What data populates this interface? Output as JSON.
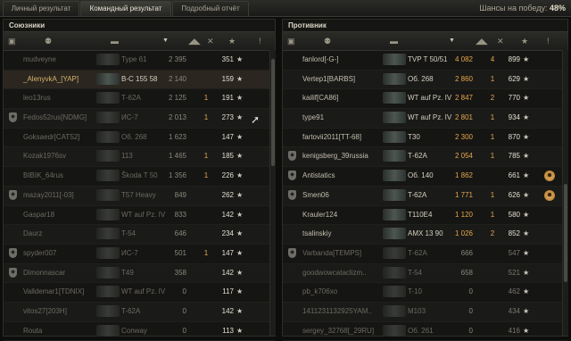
{
  "tabs": [
    "Личный результат",
    "Командный результат",
    "Подробный отчёт"
  ],
  "active_tab": 1,
  "win_chance": {
    "label": "Шансы на победу:",
    "value": "48%"
  },
  "allies": {
    "title": "Союзники",
    "rows": [
      {
        "name": "mudveyne",
        "tank": "Type 61",
        "damage": "2 395",
        "kills": "",
        "xp": "351",
        "badge": false,
        "state": "dead"
      },
      {
        "name": "_AlenyvkA_[YAP]",
        "tank": "В-С 155 58",
        "damage": "2 140",
        "kills": "",
        "xp": "159",
        "badge": false,
        "state": "self"
      },
      {
        "name": "leo13rus",
        "tank": "Т-62А",
        "damage": "2 125",
        "kills": "1",
        "xp": "191",
        "badge": false,
        "state": "dead"
      },
      {
        "name": "Fedos52rus[NDMG]",
        "tank": "ИС-7",
        "damage": "2 013",
        "kills": "1",
        "xp": "273",
        "badge": true,
        "state": "dead"
      },
      {
        "name": "Goksaedr[CAT52]",
        "tank": "Об. 268",
        "damage": "1 623",
        "kills": "",
        "xp": "147",
        "badge": false,
        "state": "dead"
      },
      {
        "name": "Kozak1976sv",
        "tank": "113",
        "damage": "1 465",
        "kills": "1",
        "xp": "185",
        "badge": false,
        "state": "dead"
      },
      {
        "name": "BIBIK_64rus",
        "tank": "Škoda T 50",
        "damage": "1 356",
        "kills": "1",
        "xp": "226",
        "badge": false,
        "state": "dead"
      },
      {
        "name": "mazay2011[-03]",
        "tank": "T57 Heavy",
        "damage": "849",
        "kills": "",
        "xp": "262",
        "badge": true,
        "state": "dead"
      },
      {
        "name": "Gaspar18",
        "tank": "WT auf Pz. IV",
        "damage": "833",
        "kills": "",
        "xp": "142",
        "badge": false,
        "state": "dead"
      },
      {
        "name": "Daurz",
        "tank": "T-54",
        "damage": "646",
        "kills": "",
        "xp": "234",
        "badge": false,
        "state": "dead"
      },
      {
        "name": "spyder007",
        "tank": "ИС-7",
        "damage": "501",
        "kills": "1",
        "xp": "147",
        "badge": true,
        "state": "dead"
      },
      {
        "name": "Dimonnascar",
        "tank": "T49",
        "damage": "358",
        "kills": "",
        "xp": "142",
        "badge": true,
        "state": "dead"
      },
      {
        "name": "Valldemar1[TDNIX]",
        "tank": "WT auf Pz. IV",
        "damage": "0",
        "kills": "",
        "xp": "117",
        "badge": false,
        "state": "dead"
      },
      {
        "name": "vitos27[203H]",
        "tank": "T-62A",
        "damage": "0",
        "kills": "",
        "xp": "142",
        "badge": false,
        "state": "dead"
      },
      {
        "name": "Routa",
        "tank": "Conway",
        "damage": "0",
        "kills": "",
        "xp": "113",
        "badge": false,
        "state": "dead"
      }
    ]
  },
  "enemies": {
    "title": "Противник",
    "rows": [
      {
        "name": "fanlord[-G-]",
        "tank": "TVP T 50/51",
        "damage": "4 082",
        "kills": "4",
        "xp": "899",
        "badge": false,
        "state": "alive",
        "medal": false
      },
      {
        "name": "Vertep1[BARBS]",
        "tank": "Об. 268",
        "damage": "2 860",
        "kills": "1",
        "xp": "629",
        "badge": false,
        "state": "alive",
        "medal": false
      },
      {
        "name": "kailif[CA86]",
        "tank": "WT auf Pz. IV",
        "damage": "2 847",
        "kills": "2",
        "xp": "770",
        "badge": false,
        "state": "alive",
        "medal": false
      },
      {
        "name": "type91",
        "tank": "WT auf Pz. IV",
        "damage": "2 801",
        "kills": "1",
        "xp": "934",
        "badge": false,
        "state": "alive",
        "medal": false
      },
      {
        "name": "fartovii2011[TT-68]",
        "tank": "T30",
        "damage": "2 300",
        "kills": "1",
        "xp": "870",
        "badge": false,
        "state": "alive",
        "medal": false
      },
      {
        "name": "kenigsberg_39russia",
        "tank": "Т-62А",
        "damage": "2 054",
        "kills": "1",
        "xp": "785",
        "badge": true,
        "state": "alive",
        "medal": false
      },
      {
        "name": "Antistatics",
        "tank": "Об. 140",
        "damage": "1 862",
        "kills": "",
        "xp": "661",
        "badge": true,
        "state": "alive",
        "medal": true
      },
      {
        "name": "Smen06",
        "tank": "T-62A",
        "damage": "1 771",
        "kills": "1",
        "xp": "626",
        "badge": true,
        "state": "alive",
        "medal": true
      },
      {
        "name": "Krauler124",
        "tank": "T110E4",
        "damage": "1 120",
        "kills": "1",
        "xp": "580",
        "badge": false,
        "state": "alive",
        "medal": false
      },
      {
        "name": "tsalinskiy",
        "tank": "AMX 13 90",
        "damage": "1 026",
        "kills": "2",
        "xp": "852",
        "badge": false,
        "state": "alive",
        "medal": false
      },
      {
        "name": "Varbanda[TEMPS]",
        "tank": "Т-62А",
        "damage": "666",
        "kills": "",
        "xp": "547",
        "badge": true,
        "state": "dead",
        "medal": false
      },
      {
        "name": "goodwowcataclizm..",
        "tank": "T-54",
        "damage": "658",
        "kills": "",
        "xp": "521",
        "badge": false,
        "state": "dead",
        "medal": false
      },
      {
        "name": "pb_k706xo",
        "tank": "T-10",
        "damage": "0",
        "kills": "",
        "xp": "462",
        "badge": false,
        "state": "dead",
        "medal": false
      },
      {
        "name": "1411231132925YAM..",
        "tank": "M103",
        "damage": "0",
        "kills": "",
        "xp": "434",
        "badge": false,
        "state": "dead",
        "medal": false
      },
      {
        "name": "sergey_32768[_29RU]",
        "tank": "Об. 261",
        "damage": "0",
        "kills": "",
        "xp": "416",
        "badge": false,
        "state": "dead",
        "medal": false
      }
    ]
  },
  "icons": {
    "star": "★",
    "badge": "shield-icon",
    "medal": "medal-icon"
  }
}
